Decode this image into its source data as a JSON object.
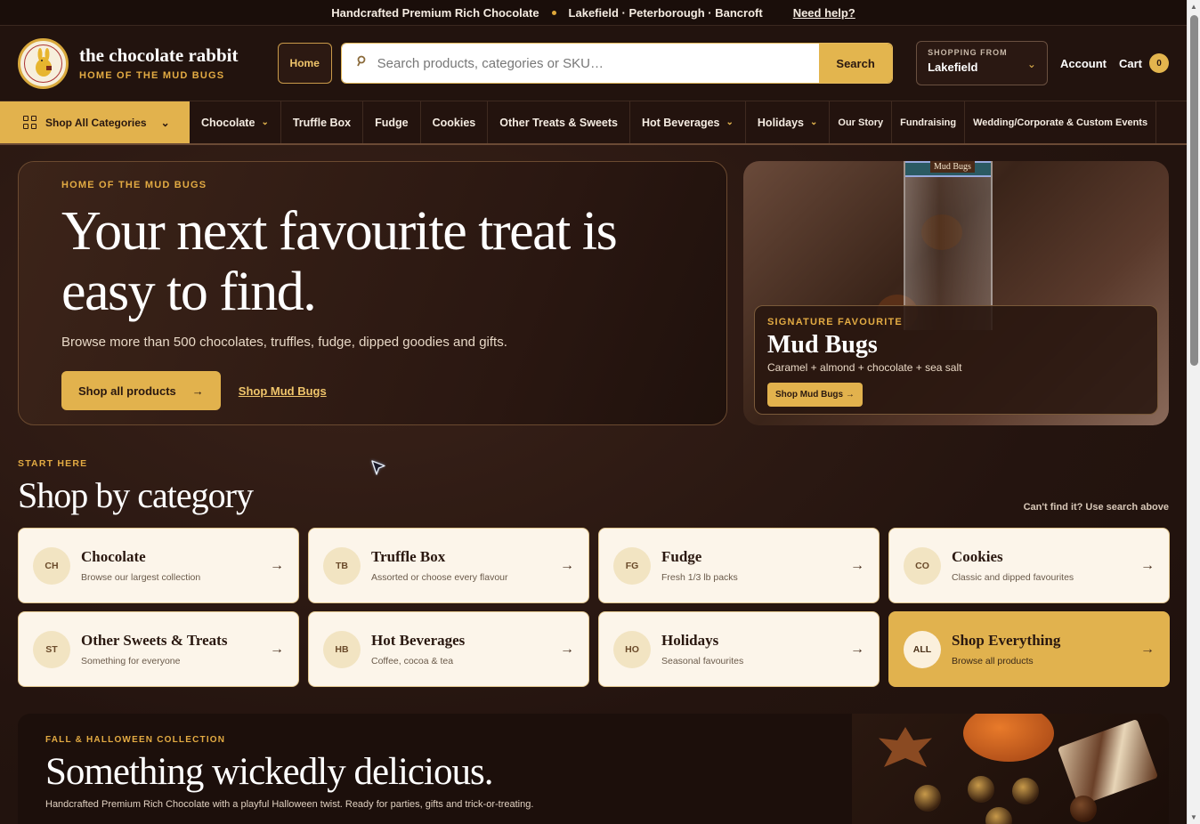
{
  "topbar": {
    "tagline": "Handcrafted Premium Rich Chocolate",
    "locations": "Lakefield · Peterborough · Bancroft",
    "help": "Need help?"
  },
  "header": {
    "brand_title": "the chocolate rabbit",
    "brand_subtitle": "HOME OF THE MUD BUGS",
    "home_label": "Home",
    "search_placeholder": "Search products, categories or SKU…",
    "search_button": "Search",
    "shopping_from_label": "SHOPPING FROM",
    "shopping_from_value": "Lakefield",
    "account_label": "Account",
    "cart_label": "Cart",
    "cart_count": "0"
  },
  "nav": {
    "all_categories": "Shop All Categories",
    "items": [
      {
        "label": "Chocolate",
        "dropdown": true
      },
      {
        "label": "Truffle Box",
        "dropdown": false
      },
      {
        "label": "Fudge",
        "dropdown": false
      },
      {
        "label": "Cookies",
        "dropdown": false
      },
      {
        "label": "Other Treats & Sweets",
        "dropdown": false
      },
      {
        "label": "Hot Beverages",
        "dropdown": true
      },
      {
        "label": "Holidays",
        "dropdown": true
      },
      {
        "label": "Our Story",
        "dropdown": false
      },
      {
        "label": "Fundraising",
        "dropdown": false
      },
      {
        "label": "Wedding/Corporate & Custom Events",
        "dropdown": false
      }
    ]
  },
  "hero": {
    "eyebrow": "HOME OF THE MUD BUGS",
    "title": "Your next favourite treat is easy to find.",
    "lede": "Browse more than 500 chocolates, truffles, fudge, dipped goodies and gifts.",
    "primary_cta": "Shop all products",
    "secondary_cta": "Shop Mud Bugs"
  },
  "feature": {
    "jar_label": "Mud Bugs",
    "eyebrow": "SIGNATURE FAVOURITE",
    "title": "Mud Bugs",
    "desc": "Caramel + almond + chocolate + sea salt",
    "cta": "Shop Mud Bugs →"
  },
  "categories": {
    "eyebrow": "START HERE",
    "title": "Shop by category",
    "hint": "Can't find it? Use search above",
    "cards": [
      {
        "abbr": "CH",
        "name": "Chocolate",
        "desc": "Browse our largest collection"
      },
      {
        "abbr": "TB",
        "name": "Truffle Box",
        "desc": "Assorted or choose every flavour"
      },
      {
        "abbr": "FG",
        "name": "Fudge",
        "desc": "Fresh 1/3 lb packs"
      },
      {
        "abbr": "CO",
        "name": "Cookies",
        "desc": "Classic and dipped favourites"
      },
      {
        "abbr": "ST",
        "name": "Other Sweets & Treats",
        "desc": "Something for everyone"
      },
      {
        "abbr": "HB",
        "name": "Hot Beverages",
        "desc": "Coffee, cocoa & tea"
      },
      {
        "abbr": "HO",
        "name": "Holidays",
        "desc": "Seasonal favourites"
      },
      {
        "abbr": "ALL",
        "name": "Shop Everything",
        "desc": "Browse all products"
      }
    ]
  },
  "halloween": {
    "eyebrow": "FALL & HALLOWEEN COLLECTION",
    "title": "Something wickedly delicious.",
    "desc": "Handcrafted Premium Rich Chocolate with a playful Halloween twist. Ready for parties, gifts and trick-or-treating."
  },
  "colors": {
    "accent_gold": "#e2b24d",
    "background": "#24140f",
    "card": "#fcf5ea"
  }
}
